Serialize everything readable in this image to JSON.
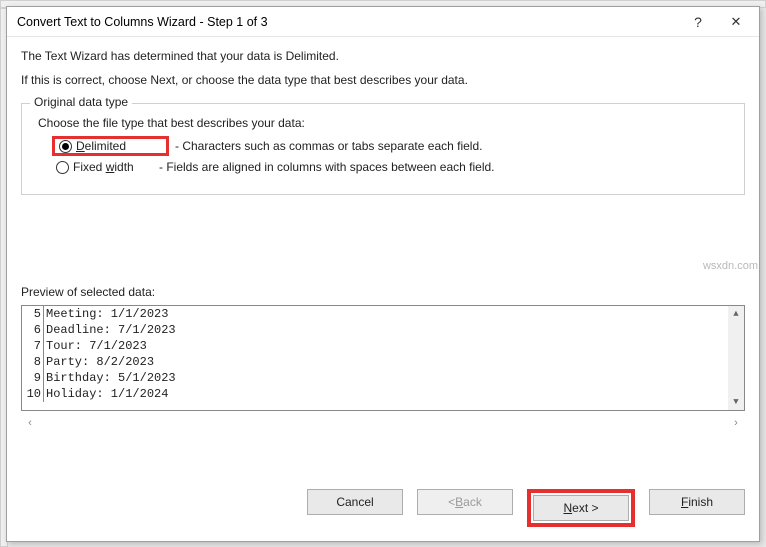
{
  "titlebar": {
    "title": "Convert Text to Columns Wizard - Step 1 of 3"
  },
  "intro": {
    "line1": "The Text Wizard has determined that your data is Delimited.",
    "line2": "If this is correct, choose Next, or choose the data type that best describes your data."
  },
  "group": {
    "legend": "Original data type",
    "choose": "Choose the file type that best describes your data:",
    "delimited_label_pre": "D",
    "delimited_label_rest": "elimited",
    "delimited_desc": "- Characters such as commas or tabs separate each field.",
    "fixed_label_pre": "Fixed ",
    "fixed_label_ul": "w",
    "fixed_label_rest": "idth",
    "fixed_desc": "- Fields are aligned in columns with spaces between each field."
  },
  "preview": {
    "label": "Preview of selected data:",
    "rows": [
      {
        "n": "5",
        "text": "Meeting: 1/1/2023"
      },
      {
        "n": "6",
        "text": "Deadline: 7/1/2023"
      },
      {
        "n": "7",
        "text": "Tour: 7/1/2023"
      },
      {
        "n": "8",
        "text": "Party: 8/2/2023"
      },
      {
        "n": "9",
        "text": "Birthday: 5/1/2023"
      },
      {
        "n": "10",
        "text": "Holiday: 1/1/2024"
      }
    ]
  },
  "buttons": {
    "cancel": "Cancel",
    "back_pre": "< ",
    "back_ul": "B",
    "back_rest": "ack",
    "next_ul": "N",
    "next_rest": "ext >",
    "finish_ul": "F",
    "finish_rest": "inish"
  },
  "watermark": "wsxdn.com"
}
